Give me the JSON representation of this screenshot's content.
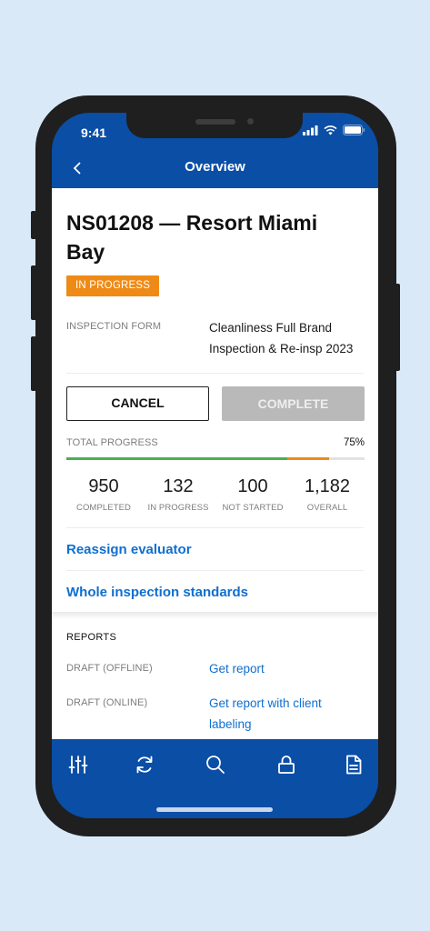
{
  "status_bar": {
    "time": "9:41"
  },
  "nav": {
    "title": "Overview",
    "back_icon": "chevron-left-icon"
  },
  "inspection": {
    "title": "NS01208 — Resort Miami Bay",
    "status": "IN PROGRESS",
    "status_color": "#ef8a16",
    "form_label": "INSPECTION FORM",
    "form_value": "Cleanliness Full Brand Inspection & Re-insp 2023"
  },
  "actions": {
    "cancel_label": "CANCEL",
    "complete_label": "COMPLETE"
  },
  "progress": {
    "label": "TOTAL PROGRESS",
    "percent_text": "75%",
    "completed_fraction": 0.74,
    "in_progress_fraction": 0.14
  },
  "stats": [
    {
      "value": "950",
      "label": "COMPLETED"
    },
    {
      "value": "132",
      "label": "IN PROGRESS"
    },
    {
      "value": "100",
      "label": "NOT STARTED"
    },
    {
      "value": "1,182",
      "label": "OVERALL"
    }
  ],
  "links": {
    "reassign": "Reassign evaluator",
    "standards": "Whole inspection standards"
  },
  "reports": {
    "heading": "REPORTS",
    "rows": [
      {
        "label": "DRAFT (OFFLINE)",
        "link": "Get report"
      },
      {
        "label": "DRAFT (ONLINE)",
        "link": "Get report with client labeling"
      }
    ]
  },
  "tabbar": {
    "icons": [
      "sliders-icon",
      "sync-icon",
      "search-icon",
      "lock-icon",
      "document-icon"
    ]
  },
  "colors": {
    "primary": "#0a4ea6",
    "link": "#0f6fcf",
    "accent": "#ef8a16",
    "success": "#4caf50"
  }
}
